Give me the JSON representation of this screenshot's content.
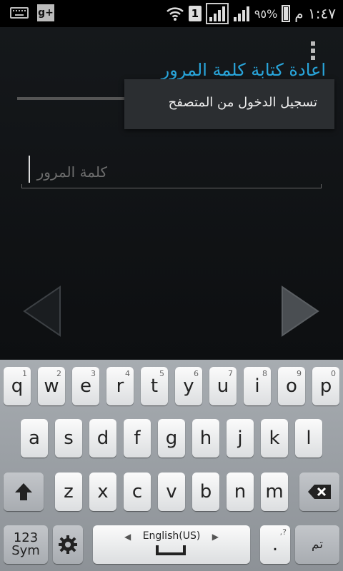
{
  "status_bar": {
    "icons_left": [
      "keyboard-icon",
      "google-plus-icon"
    ],
    "gplus_text": "g+",
    "sim_slot": "1",
    "battery_percent": "٩٥%",
    "clock": "١:٤٧ م"
  },
  "screen": {
    "title": "اعادة كتابة كلمة المرور",
    "menu_item": "تسجيل الدخول من المتصفح",
    "password_placeholder": "كلمة المرور"
  },
  "keyboard": {
    "row1": [
      {
        "label": "q",
        "num": "1"
      },
      {
        "label": "w",
        "num": "2"
      },
      {
        "label": "e",
        "num": "3"
      },
      {
        "label": "r",
        "num": "4"
      },
      {
        "label": "t",
        "num": "5"
      },
      {
        "label": "y",
        "num": "6"
      },
      {
        "label": "u",
        "num": "7"
      },
      {
        "label": "i",
        "num": "8"
      },
      {
        "label": "o",
        "num": "9"
      },
      {
        "label": "p",
        "num": "0"
      }
    ],
    "row2": [
      "a",
      "s",
      "d",
      "f",
      "g",
      "h",
      "j",
      "k",
      "l"
    ],
    "row3": [
      "z",
      "x",
      "c",
      "v",
      "b",
      "n",
      "m"
    ],
    "sym_top": "123",
    "sym_bottom": "Sym",
    "language": "English(US)",
    "period": ".",
    "period_hint": ",?",
    "done_label": "تم"
  }
}
